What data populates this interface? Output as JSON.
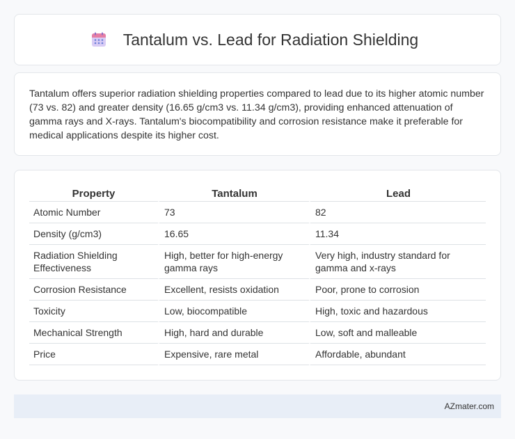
{
  "header": {
    "title": "Tantalum vs. Lead for Radiation Shielding",
    "icon": "calendar-grid-icon"
  },
  "summary": {
    "text": "Tantalum offers superior radiation shielding properties compared to lead due to its higher atomic number (73 vs. 82) and greater density (16.65 g/cm3 vs. 11.34 g/cm3), providing enhanced attenuation of gamma rays and X-rays. Tantalum's biocompatibility and corrosion resistance make it preferable for medical applications despite its higher cost."
  },
  "table": {
    "headers": [
      "Property",
      "Tantalum",
      "Lead"
    ],
    "rows": [
      [
        "Atomic Number",
        "73",
        "82"
      ],
      [
        "Density (g/cm3)",
        "16.65",
        "11.34"
      ],
      [
        "Radiation Shielding Effectiveness",
        "High, better for high-energy gamma rays",
        "Very high, industry standard for gamma and x-rays"
      ],
      [
        "Corrosion Resistance",
        "Excellent, resists oxidation",
        "Poor, prone to corrosion"
      ],
      [
        "Toxicity",
        "Low, biocompatible",
        "High, toxic and hazardous"
      ],
      [
        "Mechanical Strength",
        "High, hard and durable",
        "Low, soft and malleable"
      ],
      [
        "Price",
        "Expensive, rare metal",
        "Affordable, abundant"
      ]
    ]
  },
  "footer": {
    "brand": "AZmater.com"
  },
  "colors": {
    "background": "#f8f9fb",
    "card": "#ffffff",
    "footer": "#e8eef7",
    "icon_top": "#e57ea5",
    "icon_body": "#c9b8ee",
    "icon_dots": "#6a7fd8"
  }
}
